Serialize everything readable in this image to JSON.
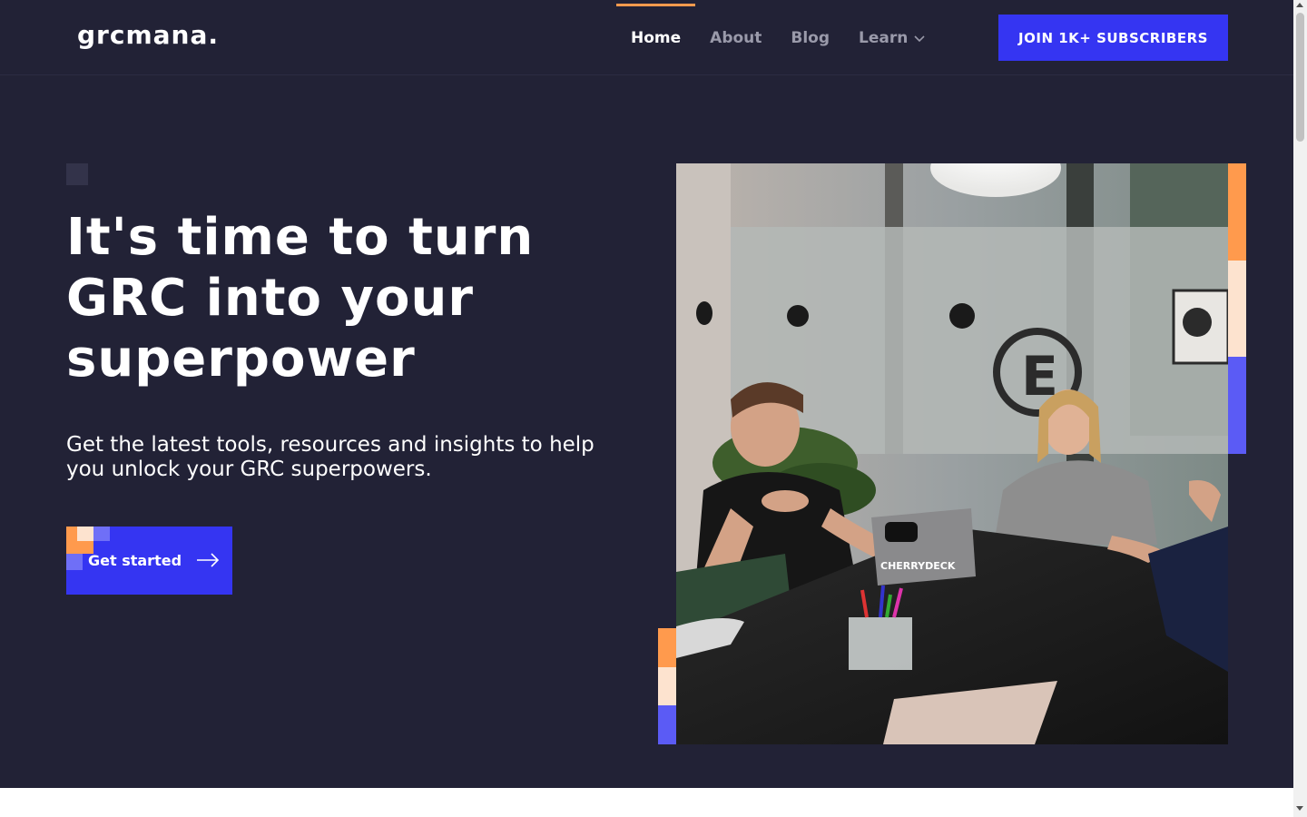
{
  "header": {
    "logo": "grcmana.",
    "nav": [
      {
        "label": "Home",
        "active": true
      },
      {
        "label": "About",
        "active": false
      },
      {
        "label": "Blog",
        "active": false
      },
      {
        "label": "Learn",
        "active": false,
        "has_dropdown": true
      }
    ],
    "cta": "JOIN 1K+ SUBSCRIBERS"
  },
  "hero": {
    "title": "It's time to turn GRC into your superpower",
    "subtitle": "Get the latest tools, resources and insights to help you unlock your GRC superpowers.",
    "button": "Get started",
    "button_icon": "arrow-right-icon",
    "image_description_icon": "meeting-photo"
  },
  "colors": {
    "background": "#222236",
    "accent_blue": "#3535f2",
    "accent_orange": "#ff9a4d",
    "accent_peach": "#fde3cf",
    "accent_periwinkle": "#5b5bf5",
    "text_muted": "#9a9aaa"
  }
}
